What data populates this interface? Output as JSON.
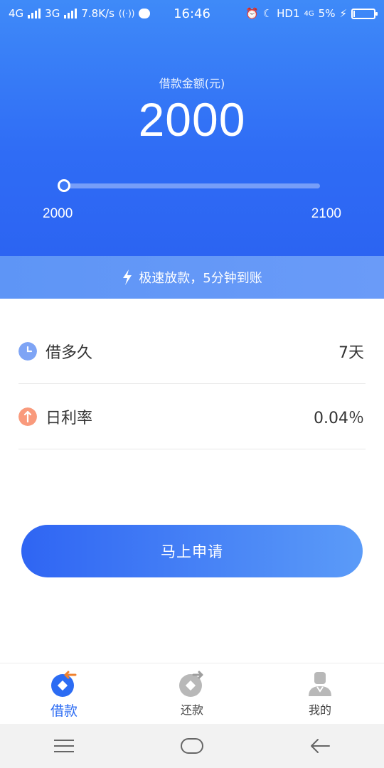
{
  "status_bar": {
    "network_1": "4G",
    "network_2": "3G",
    "speed": "7.8K/s",
    "time": "16:46",
    "hd": "HD1",
    "battery_percent": "5%"
  },
  "loan": {
    "amount_label": "借款金额(元)",
    "amount": "2000",
    "slider": {
      "min_label": "2000",
      "max_label": "2100",
      "min": 2000,
      "max": 2100,
      "value": 2000
    }
  },
  "banner": {
    "text": "极速放款，5分钟到账",
    "icon": "lightning-icon"
  },
  "details": [
    {
      "label": "借多久",
      "value": "7天",
      "icon": "clock-icon",
      "color": "#7ea4f5"
    },
    {
      "label": "日利率",
      "value": "0.04％",
      "icon": "rate-icon",
      "color": "#f99a7c"
    }
  ],
  "apply_button": {
    "label": "马上申请"
  },
  "tabs": [
    {
      "label": "借款",
      "icon": "borrow-icon",
      "active": true
    },
    {
      "label": "还款",
      "icon": "repay-icon",
      "active": false
    },
    {
      "label": "我的",
      "icon": "profile-icon",
      "active": false
    }
  ],
  "colors": {
    "primary": "#2f6cf5",
    "accent": "#f99a7c",
    "tab_active": "#2c6cf3"
  }
}
